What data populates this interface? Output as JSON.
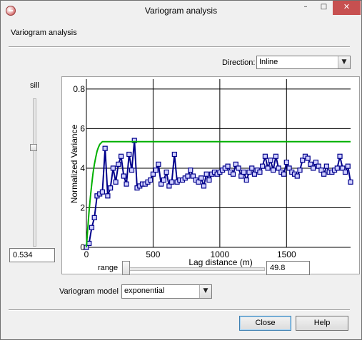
{
  "window": {
    "title": "Variogram analysis",
    "controls": {
      "minimize": "–",
      "maximize": "□",
      "close": "✕"
    }
  },
  "section_title": "Variogram analysis",
  "direction": {
    "label": "Direction:",
    "value": "Inline"
  },
  "sill": {
    "label": "sill",
    "value": "0.534"
  },
  "range": {
    "label": "range",
    "value": "49.8"
  },
  "model": {
    "label": "Variogram model",
    "value": "exponential"
  },
  "buttons": {
    "close": "Close",
    "help": "Help"
  },
  "chart_data": {
    "type": "line",
    "xlabel": "Lag distance (m)",
    "ylabel": "Normalized Variance",
    "xlim": [
      0,
      1980
    ],
    "ylim": [
      0,
      0.85
    ],
    "x_ticks": [
      0,
      500,
      1000,
      1500
    ],
    "y_ticks": [
      0,
      0.2,
      0.4,
      0.6,
      0.8
    ],
    "y_tick_labels": [
      "0",
      "2",
      "4",
      "6",
      "0.8"
    ],
    "grid": true,
    "series": [
      {
        "role": "experimental variogram",
        "color": "#00008b",
        "marker": "square",
        "x": [
          0,
          20,
          40,
          60,
          80,
          100,
          120,
          140,
          160,
          180,
          200,
          220,
          240,
          260,
          280,
          300,
          320,
          340,
          360,
          380,
          400,
          420,
          440,
          460,
          480,
          500,
          520,
          540,
          560,
          580,
          600,
          620,
          640,
          660,
          680,
          700,
          720,
          740,
          760,
          780,
          800,
          820,
          840,
          860,
          880,
          900,
          920,
          940,
          960,
          980,
          1000,
          1020,
          1040,
          1060,
          1080,
          1100,
          1120,
          1140,
          1160,
          1180,
          1200,
          1220,
          1240,
          1260,
          1280,
          1300,
          1320,
          1340,
          1360,
          1380,
          1400,
          1420,
          1440,
          1460,
          1480,
          1500,
          1520,
          1540,
          1560,
          1580,
          1600,
          1620,
          1640,
          1660,
          1680,
          1700,
          1720,
          1740,
          1760,
          1780,
          1800,
          1820,
          1840,
          1860,
          1880,
          1900,
          1920,
          1940,
          1960,
          1980
        ],
        "y": [
          0,
          0.02,
          0.1,
          0.15,
          0.26,
          0.27,
          0.28,
          0.5,
          0.26,
          0.3,
          0.4,
          0.33,
          0.42,
          0.46,
          0.36,
          0.32,
          0.47,
          0.39,
          0.54,
          0.3,
          0.31,
          0.32,
          0.32,
          0.33,
          0.34,
          0.37,
          0.39,
          0.42,
          0.32,
          0.34,
          0.38,
          0.31,
          0.33,
          0.47,
          0.33,
          0.34,
          0.34,
          0.35,
          0.36,
          0.39,
          0.36,
          0.34,
          0.33,
          0.35,
          0.31,
          0.37,
          0.34,
          0.37,
          0.38,
          0.37,
          0.38,
          0.39,
          0.4,
          0.41,
          0.38,
          0.37,
          0.42,
          0.4,
          0.36,
          0.38,
          0.34,
          0.38,
          0.4,
          0.37,
          0.39,
          0.38,
          0.41,
          0.46,
          0.4,
          0.44,
          0.39,
          0.46,
          0.4,
          0.38,
          0.37,
          0.43,
          0.4,
          0.38,
          0.37,
          0.36,
          0.39,
          0.44,
          0.46,
          0.45,
          0.42,
          0.4,
          0.43,
          0.41,
          0.39,
          0.37,
          0.41,
          0.38,
          0.38,
          0.39,
          0.4,
          0.46,
          0.4,
          0.38,
          0.41,
          0.33
        ]
      },
      {
        "role": "fitted model",
        "color": "#00b000",
        "marker": "none",
        "x": [
          0,
          10,
          20,
          30,
          40,
          50,
          60,
          70,
          80,
          90,
          100,
          120,
          150,
          200,
          300,
          500,
          1000,
          1500,
          1980
        ],
        "y": [
          0,
          0.095,
          0.18,
          0.255,
          0.32,
          0.375,
          0.42,
          0.455,
          0.485,
          0.505,
          0.52,
          0.534,
          0.534,
          0.534,
          0.534,
          0.534,
          0.534,
          0.534,
          0.534
        ]
      }
    ]
  }
}
